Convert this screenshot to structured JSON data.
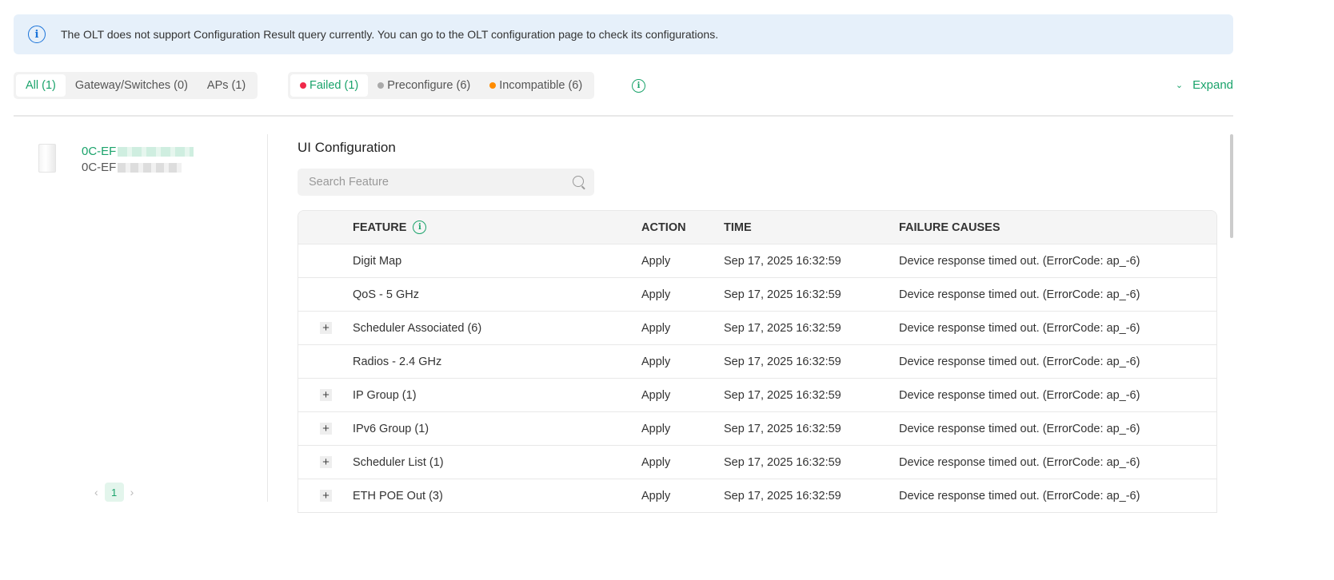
{
  "banner": {
    "text": "The OLT does not support Configuration Result query currently. You can go to the OLT configuration page to check its configurations."
  },
  "device_tabs": [
    {
      "label": "All (1)",
      "active": true
    },
    {
      "label": "Gateway/Switches (0)",
      "active": false
    },
    {
      "label": "APs (1)",
      "active": false
    }
  ],
  "status_tabs": [
    {
      "label": "Failed (1)",
      "color": "#f0284a",
      "active": true
    },
    {
      "label": "Preconfigure (6)",
      "color": "#aaaaaa",
      "active": false
    },
    {
      "label": "Incompatible (6)",
      "color": "#ff8c00",
      "active": false
    }
  ],
  "expand_label": "Expand",
  "device": {
    "name": "0C-EF",
    "mac": "0C-EF"
  },
  "pagination": {
    "current": "1"
  },
  "section_title": "UI Configuration",
  "search": {
    "placeholder": "Search Feature",
    "value": ""
  },
  "table": {
    "headers": [
      "FEATURE",
      "ACTION",
      "TIME",
      "FAILURE CAUSES"
    ],
    "rows": [
      {
        "expand": false,
        "feature": "Digit Map",
        "action": "Apply",
        "time": "Sep 17, 2025 16:32:59",
        "cause": "Device response timed out. (ErrorCode: ap_-6)"
      },
      {
        "expand": false,
        "feature": "QoS - 5 GHz",
        "action": "Apply",
        "time": "Sep 17, 2025 16:32:59",
        "cause": "Device response timed out. (ErrorCode: ap_-6)"
      },
      {
        "expand": true,
        "feature": "Scheduler Associated (6)",
        "action": "Apply",
        "time": "Sep 17, 2025 16:32:59",
        "cause": "Device response timed out. (ErrorCode: ap_-6)"
      },
      {
        "expand": false,
        "feature": "Radios - 2.4 GHz",
        "action": "Apply",
        "time": "Sep 17, 2025 16:32:59",
        "cause": "Device response timed out. (ErrorCode: ap_-6)"
      },
      {
        "expand": true,
        "feature": "IP Group (1)",
        "action": "Apply",
        "time": "Sep 17, 2025 16:32:59",
        "cause": "Device response timed out. (ErrorCode: ap_-6)"
      },
      {
        "expand": true,
        "feature": "IPv6 Group (1)",
        "action": "Apply",
        "time": "Sep 17, 2025 16:32:59",
        "cause": "Device response timed out. (ErrorCode: ap_-6)"
      },
      {
        "expand": true,
        "feature": "Scheduler List (1)",
        "action": "Apply",
        "time": "Sep 17, 2025 16:32:59",
        "cause": "Device response timed out. (ErrorCode: ap_-6)"
      },
      {
        "expand": true,
        "feature": "ETH POE Out (3)",
        "action": "Apply",
        "time": "Sep 17, 2025 16:32:59",
        "cause": "Device response timed out. (ErrorCode: ap_-6)"
      }
    ]
  }
}
